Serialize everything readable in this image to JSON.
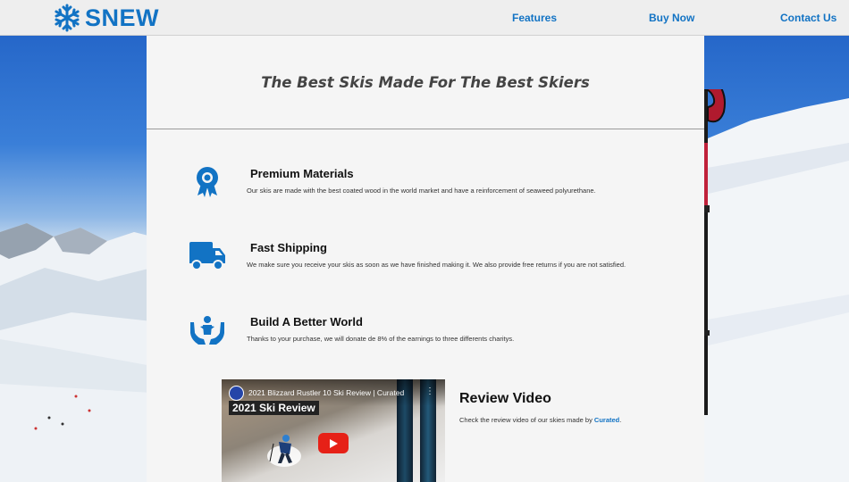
{
  "brand": {
    "name": "SNEW",
    "accent": "#1273c4"
  },
  "nav": {
    "features": "Features",
    "buy_now": "Buy Now",
    "contact_us": "Contact Us"
  },
  "hero": {
    "title": "The Best Skis Made For The Best Skiers"
  },
  "features": [
    {
      "icon": "award-icon",
      "title": "Premium Materials",
      "description": "Our skis are made with the best coated wood in the world market and have a reinforcement of seaweed polyurethane."
    },
    {
      "icon": "truck-icon",
      "title": "Fast Shipping",
      "description": "We make sure you receive your skis as soon as we have finished making it. We also provide free returns if you are not satisfied."
    },
    {
      "icon": "helping-hands-icon",
      "title": "Build A Better World",
      "description": "Thanks to your purchase, we will donate de 8% of the earnings to three differents charitys."
    }
  ],
  "video": {
    "yt_title": "2021 Blizzard Rustler 10 Ski Review | Curated",
    "banner": "2021 Ski Review",
    "heading": "Review Video",
    "description_prefix": "Check the review video of our skies made by ",
    "link_text": "Curated",
    "description_suffix": "."
  }
}
